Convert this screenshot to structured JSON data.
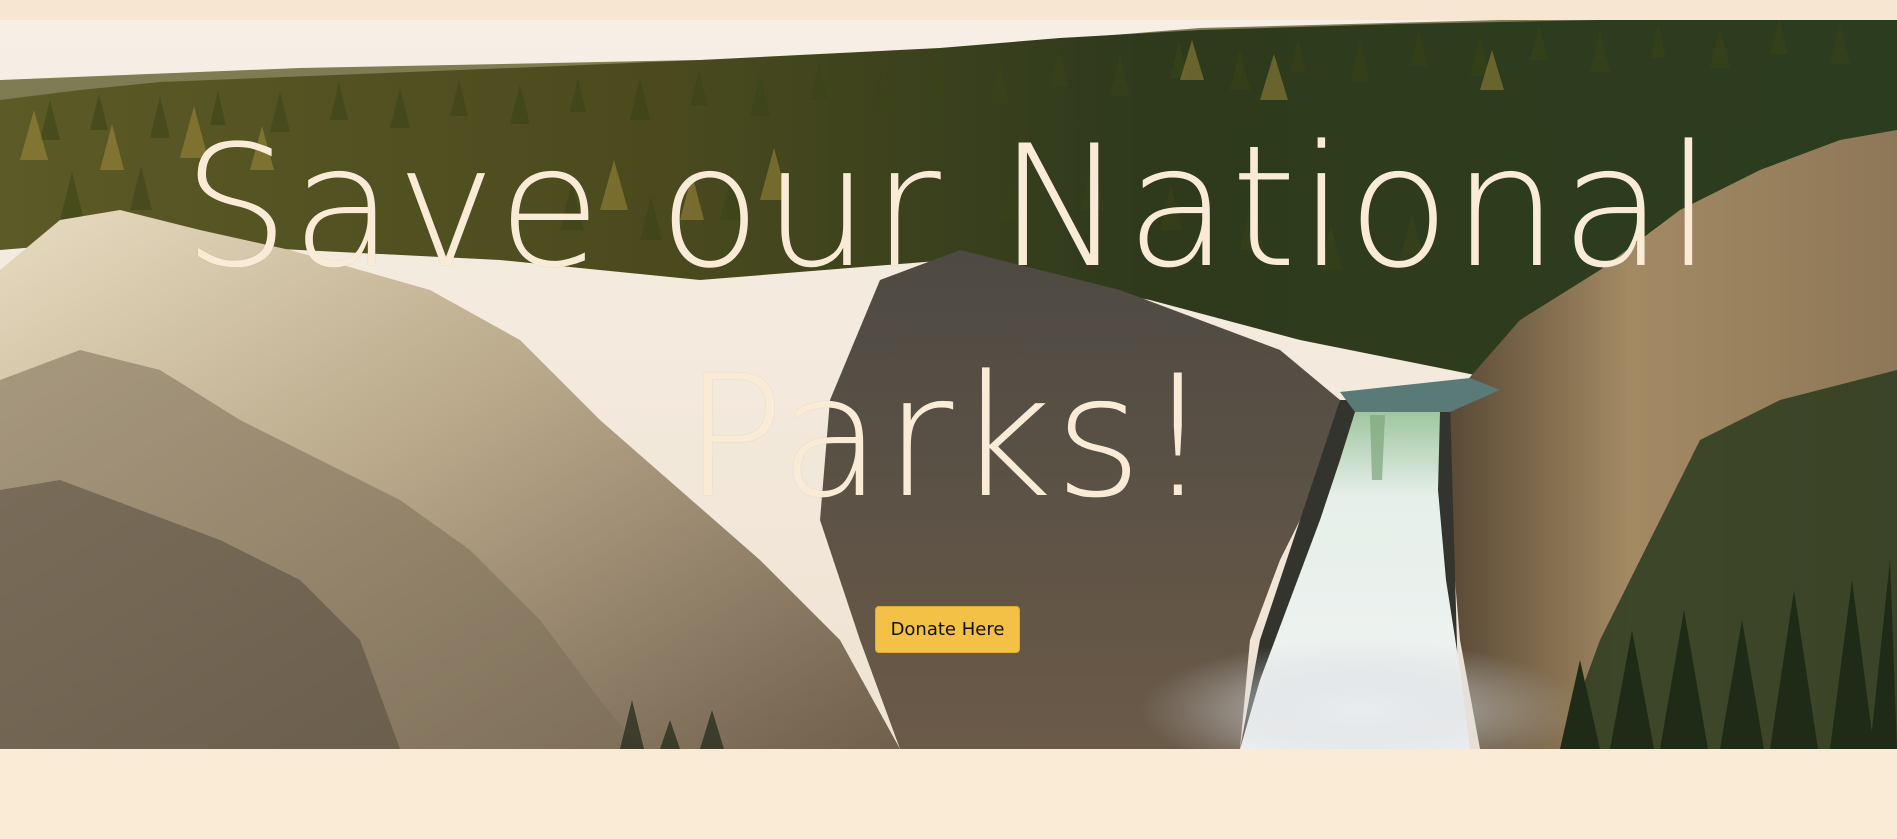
{
  "hero": {
    "title": "Save our National Parks!",
    "background_image": "waterfall-canyon-landscape",
    "donate_label": "Donate Here"
  },
  "colors": {
    "page_background": "#faebd7",
    "title_text": "#faebd7",
    "button_background": "#f2c145",
    "button_text": "#111111"
  }
}
